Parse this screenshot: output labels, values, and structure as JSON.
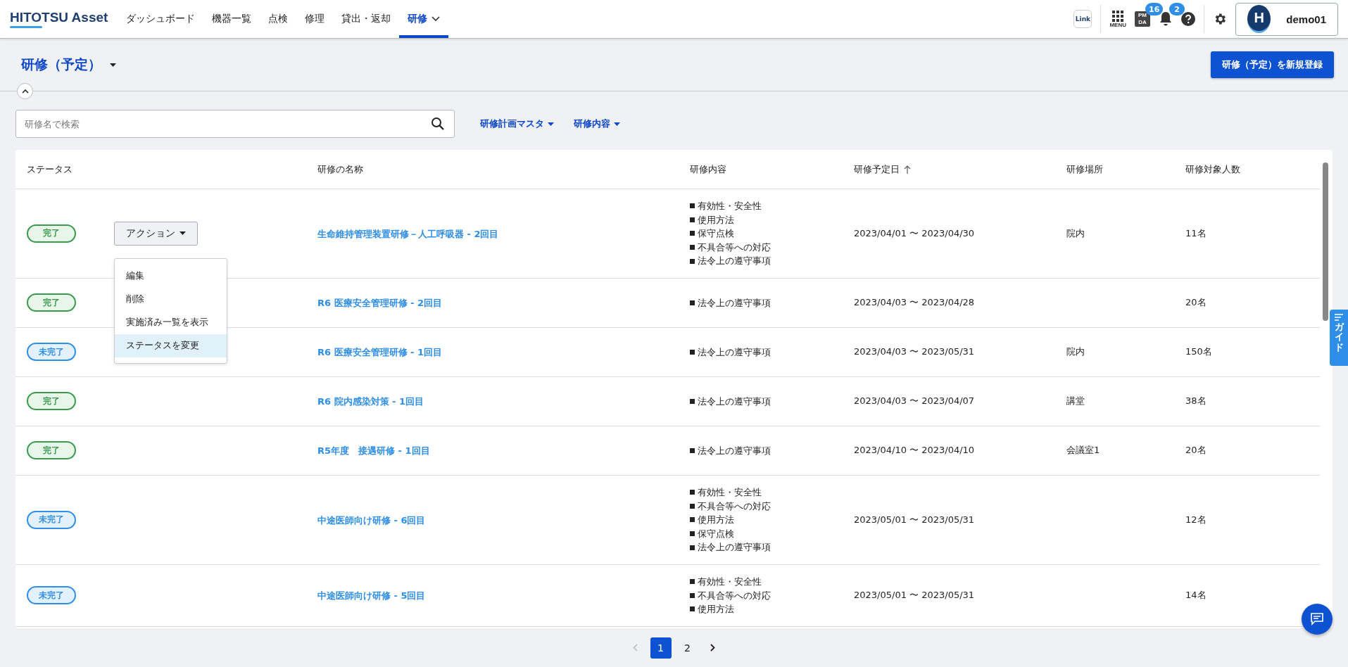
{
  "header": {
    "logo": "HITOTSU Asset",
    "nav": [
      {
        "label": "ダッシュボード",
        "selected": false
      },
      {
        "label": "機器一覧",
        "selected": false
      },
      {
        "label": "点検",
        "selected": false
      },
      {
        "label": "修理",
        "selected": false
      },
      {
        "label": "貸出・返却",
        "selected": false
      },
      {
        "label": "研修",
        "selected": true
      }
    ],
    "link_icon": "Link",
    "menu_label": "MENU",
    "pmda_icon": [
      "PM",
      "DA"
    ],
    "pmda_badge": "16",
    "bell_badge": "2",
    "user": {
      "initial": "H",
      "name": "demo01"
    }
  },
  "page": {
    "title": "研修（予定）",
    "new_button": "研修（予定）を新規登録"
  },
  "search": {
    "placeholder": "研修名で検索"
  },
  "filters": [
    "研修計画マスタ",
    "研修内容"
  ],
  "table": {
    "columns": [
      {
        "label": "ステータス",
        "sorted": false
      },
      {
        "label": "研修の名称",
        "sorted": false
      },
      {
        "label": "研修内容",
        "sorted": false
      },
      {
        "label": "研修予定日",
        "sorted": true
      },
      {
        "label": "研修場所",
        "sorted": false
      },
      {
        "label": "研修対象人数",
        "sorted": false
      }
    ],
    "rows": [
      {
        "status": "完了",
        "kind": "done",
        "action_menu_open": true,
        "name": "生命維持管理装置研修－人工呼吸器 - 2回目",
        "contents": [
          "有効性・安全性",
          "使用方法",
          "保守点検",
          "不具合等への対応",
          "法令上の遵守事項"
        ],
        "dates": "2023/04/01 〜 2023/04/30",
        "place": "院内",
        "count": "11名"
      },
      {
        "status": "完了",
        "kind": "done",
        "name": "R6 医療安全管理研修 - 2回目",
        "contents": [
          "法令上の遵守事項"
        ],
        "dates": "2023/04/03 〜 2023/04/28",
        "count": "20名"
      },
      {
        "status": "未完了",
        "kind": "pending",
        "name": "R6 医療安全管理研修 - 1回目",
        "contents": [
          "法令上の遵守事項"
        ],
        "dates": "2023/04/03 〜 2023/05/31",
        "place": "院内",
        "count": "150名"
      },
      {
        "status": "完了",
        "kind": "done",
        "name": "R6 院内感染対策 - 1回目",
        "contents": [
          "法令上の遵守事項"
        ],
        "dates": "2023/04/03 〜 2023/04/07",
        "place": "講堂",
        "count": "38名"
      },
      {
        "status": "完了",
        "kind": "done",
        "name": "R5年度　接遇研修 - 1回目",
        "contents": [
          "法令上の遵守事項"
        ],
        "dates": "2023/04/10 〜 2023/04/10",
        "place": "会議室1",
        "count": "20名"
      },
      {
        "status": "未完了",
        "kind": "pending",
        "name": "中途医師向け研修 - 6回目",
        "contents": [
          "有効性・安全性",
          "不具合等への対応",
          "使用方法",
          "保守点検",
          "法令上の遵守事項"
        ],
        "dates": "2023/05/01 〜 2023/05/31",
        "count": "12名"
      },
      {
        "status": "未完了",
        "kind": "pending",
        "name": "中途医師向け研修 - 5回目",
        "contents": [
          "有効性・安全性",
          "不具合等への対応",
          "使用方法"
        ],
        "dates": "2023/05/01 〜 2023/05/31",
        "count": "14名"
      }
    ]
  },
  "action": {
    "label": "アクション",
    "menu": [
      {
        "label": "編集",
        "selected": false
      },
      {
        "label": "削除",
        "selected": false
      },
      {
        "label": "実施済み一覧を表示",
        "selected": false
      },
      {
        "label": "ステータスを変更",
        "selected": true
      }
    ]
  },
  "pagination": {
    "pages": [
      {
        "label": "1",
        "selected": true
      },
      {
        "label": "2",
        "selected": false
      }
    ]
  },
  "guide": "ガイド"
}
